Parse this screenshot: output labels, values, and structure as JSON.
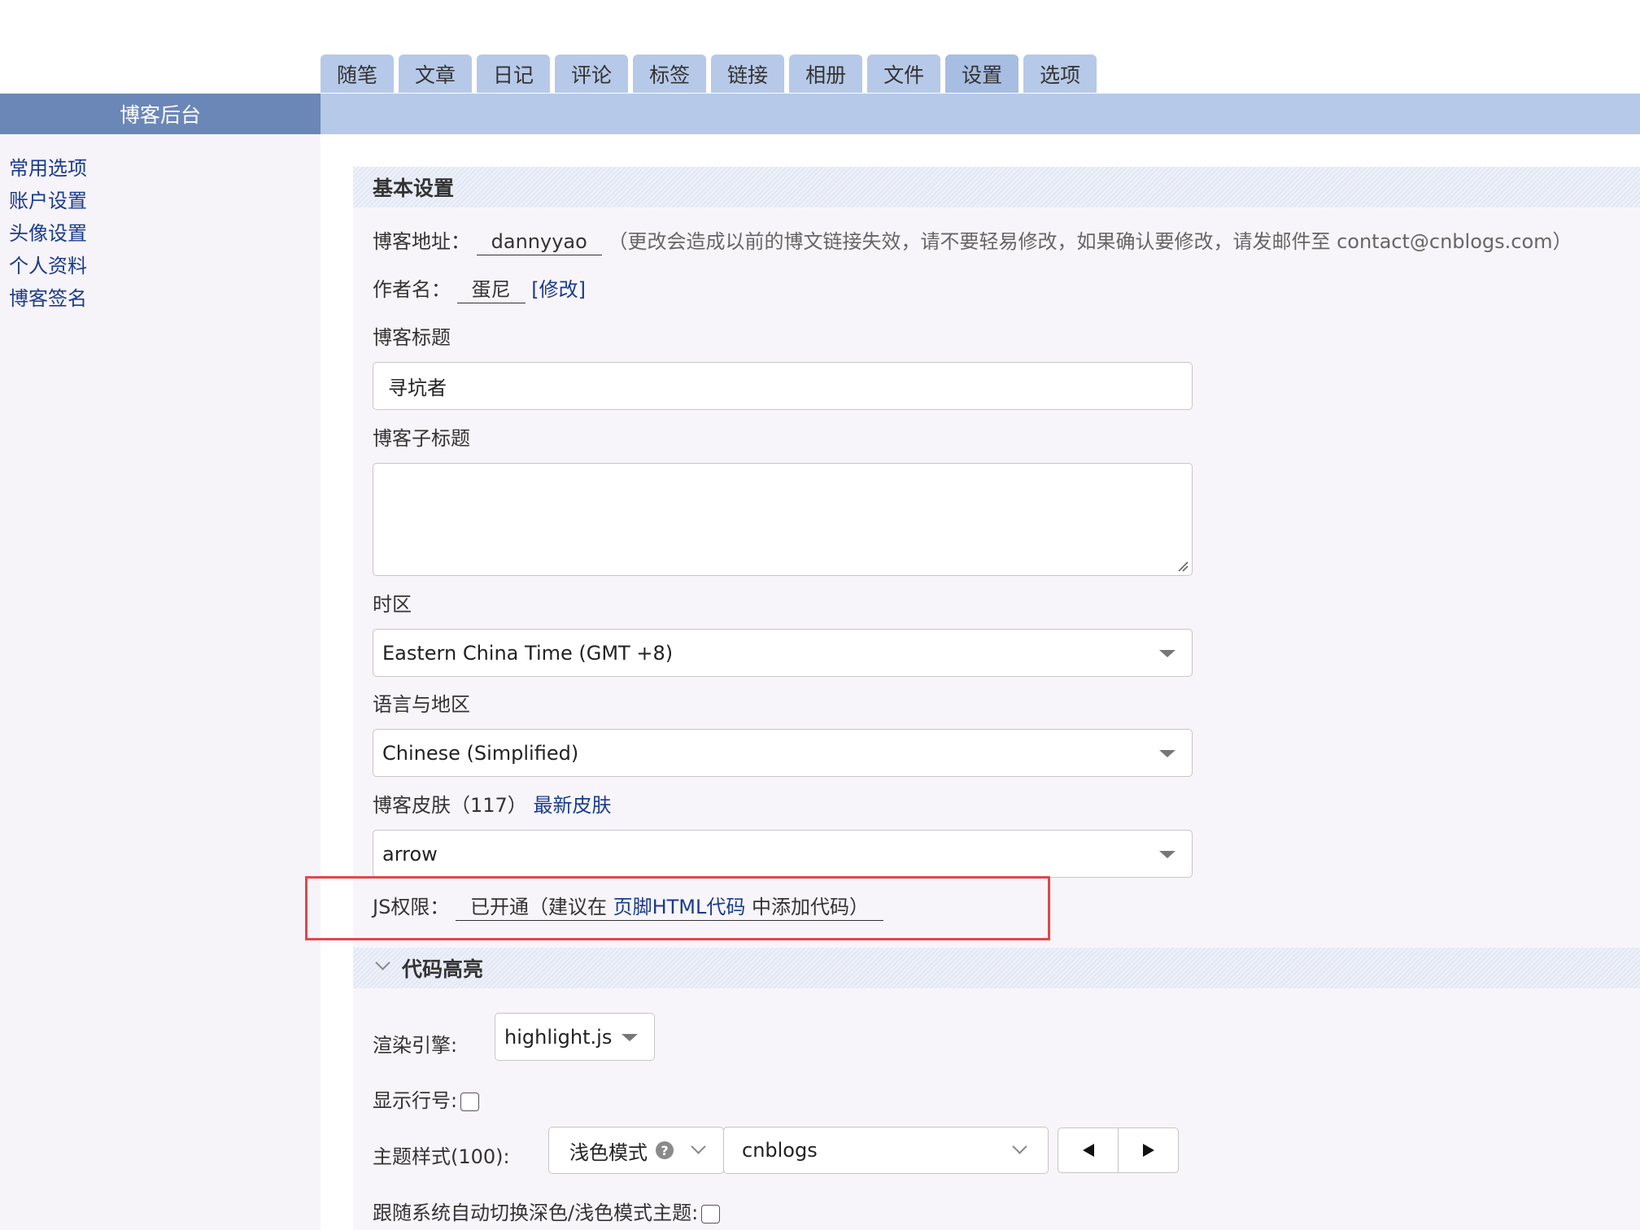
{
  "tabs": [
    {
      "label": "随笔",
      "active": false
    },
    {
      "label": "文章",
      "active": false
    },
    {
      "label": "日记",
      "active": false
    },
    {
      "label": "评论",
      "active": false
    },
    {
      "label": "标签",
      "active": false
    },
    {
      "label": "链接",
      "active": false
    },
    {
      "label": "相册",
      "active": false
    },
    {
      "label": "文件",
      "active": false
    },
    {
      "label": "设置",
      "active": true
    },
    {
      "label": "选项",
      "active": false
    }
  ],
  "sidebar": {
    "title": "博客后台",
    "items": [
      {
        "label": "常用选项"
      },
      {
        "label": "账户设置"
      },
      {
        "label": "头像设置"
      },
      {
        "label": "个人资料"
      },
      {
        "label": "博客签名"
      }
    ]
  },
  "basic": {
    "title": "基本设置",
    "blog_address_label": "博客地址：",
    "blog_address_value": "dannyyao",
    "blog_address_note": "（更改会造成以前的博文链接失效，请不要轻易修改，如果确认要修改，请发邮件至 contact@cnblogs.com）",
    "author_label": "作者名：",
    "author_value": "蛋尼",
    "author_edit": "[修改]",
    "title_label": "博客标题",
    "title_value": "寻坑者",
    "subtitle_label": "博客子标题",
    "subtitle_value": "",
    "timezone_label": "时区",
    "timezone_value": "Eastern China Time (GMT +8)",
    "language_label": "语言与地区",
    "language_value": "Chinese (Simplified)",
    "skin_label": "博客皮肤（117）",
    "skin_link": "最新皮肤",
    "skin_value": "arrow",
    "js_label": "JS权限：",
    "js_status_prefix": "已开通（建议在 ",
    "js_status_link": "页脚HTML代码",
    "js_status_suffix": " 中添加代码）"
  },
  "code": {
    "title": "代码高亮",
    "engine_label": "渲染引擎:",
    "engine_value": "highlight.js",
    "line_numbers_label": "显示行号:",
    "line_numbers_checked": false,
    "theme_label": "主题样式(100):",
    "theme_mode_value": "浅色模式",
    "theme_mode_help": "?",
    "theme_value": "cnblogs",
    "auto_switch_label": "跟随系统自动切换深色/浅色模式主题:",
    "auto_switch_checked": false
  },
  "colors": {
    "tab_bg": "#b7c9e8",
    "sidebar_head_bg": "#6a87b8",
    "link": "#1a3c8c",
    "highlight_border": "#e0474c"
  }
}
